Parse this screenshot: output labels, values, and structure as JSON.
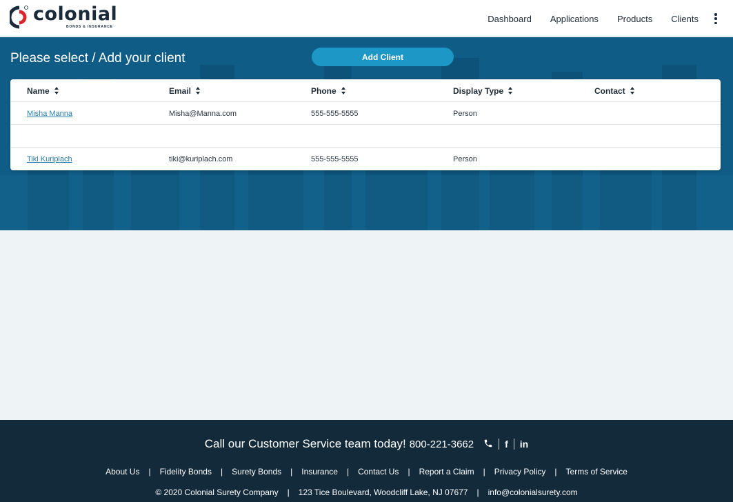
{
  "header": {
    "logo_word": "colonial",
    "logo_sub": "BONDS & INSURANCE",
    "nav": [
      "Dashboard",
      "Applications",
      "Products",
      "Clients"
    ]
  },
  "page": {
    "title": "Please select / Add your client",
    "add_client_label": "Add Client"
  },
  "table": {
    "columns": [
      "Name",
      "Email",
      "Phone",
      "Display Type",
      "Contact"
    ],
    "rows": [
      {
        "name": "Misha Manna",
        "email": "Misha@Manna.com",
        "phone": "555-555-5555",
        "type": "Person",
        "contact": ""
      },
      {
        "name": "",
        "email": "",
        "phone": "",
        "type": "",
        "contact": ""
      },
      {
        "name": "Tiki Kuriplach",
        "email": "tiki@kuriplach.com",
        "phone": "555-555-5555",
        "type": "Person",
        "contact": ""
      }
    ]
  },
  "footer": {
    "cta_text": "Call our Customer Service team today!",
    "cta_phone": "800-221-3662",
    "social": {
      "facebook": "f",
      "linkedin": "in"
    },
    "links": [
      "About Us",
      "Fidelity Bonds",
      "Surety Bonds",
      "Insurance",
      "Contact Us",
      "Report a Claim",
      "Privacy Policy",
      "Terms of Service"
    ],
    "copyright": "© 2020 Colonial Surety Company",
    "address": "123 Tice Boulevard, Woodcliff Lake, NJ 07677",
    "email": "info@colonialsurety.com"
  },
  "colors": {
    "hero": "#0f5c86",
    "accent": "#1d97c6",
    "footer": "#122a3a",
    "logo_red": "#d7282f"
  },
  "icons": {
    "logo": "colonial-logo-icon",
    "menu": "kebab-menu-icon",
    "sort": "sort-icon",
    "phone": "phone-icon",
    "facebook": "facebook-icon",
    "linkedin": "linkedin-icon"
  }
}
